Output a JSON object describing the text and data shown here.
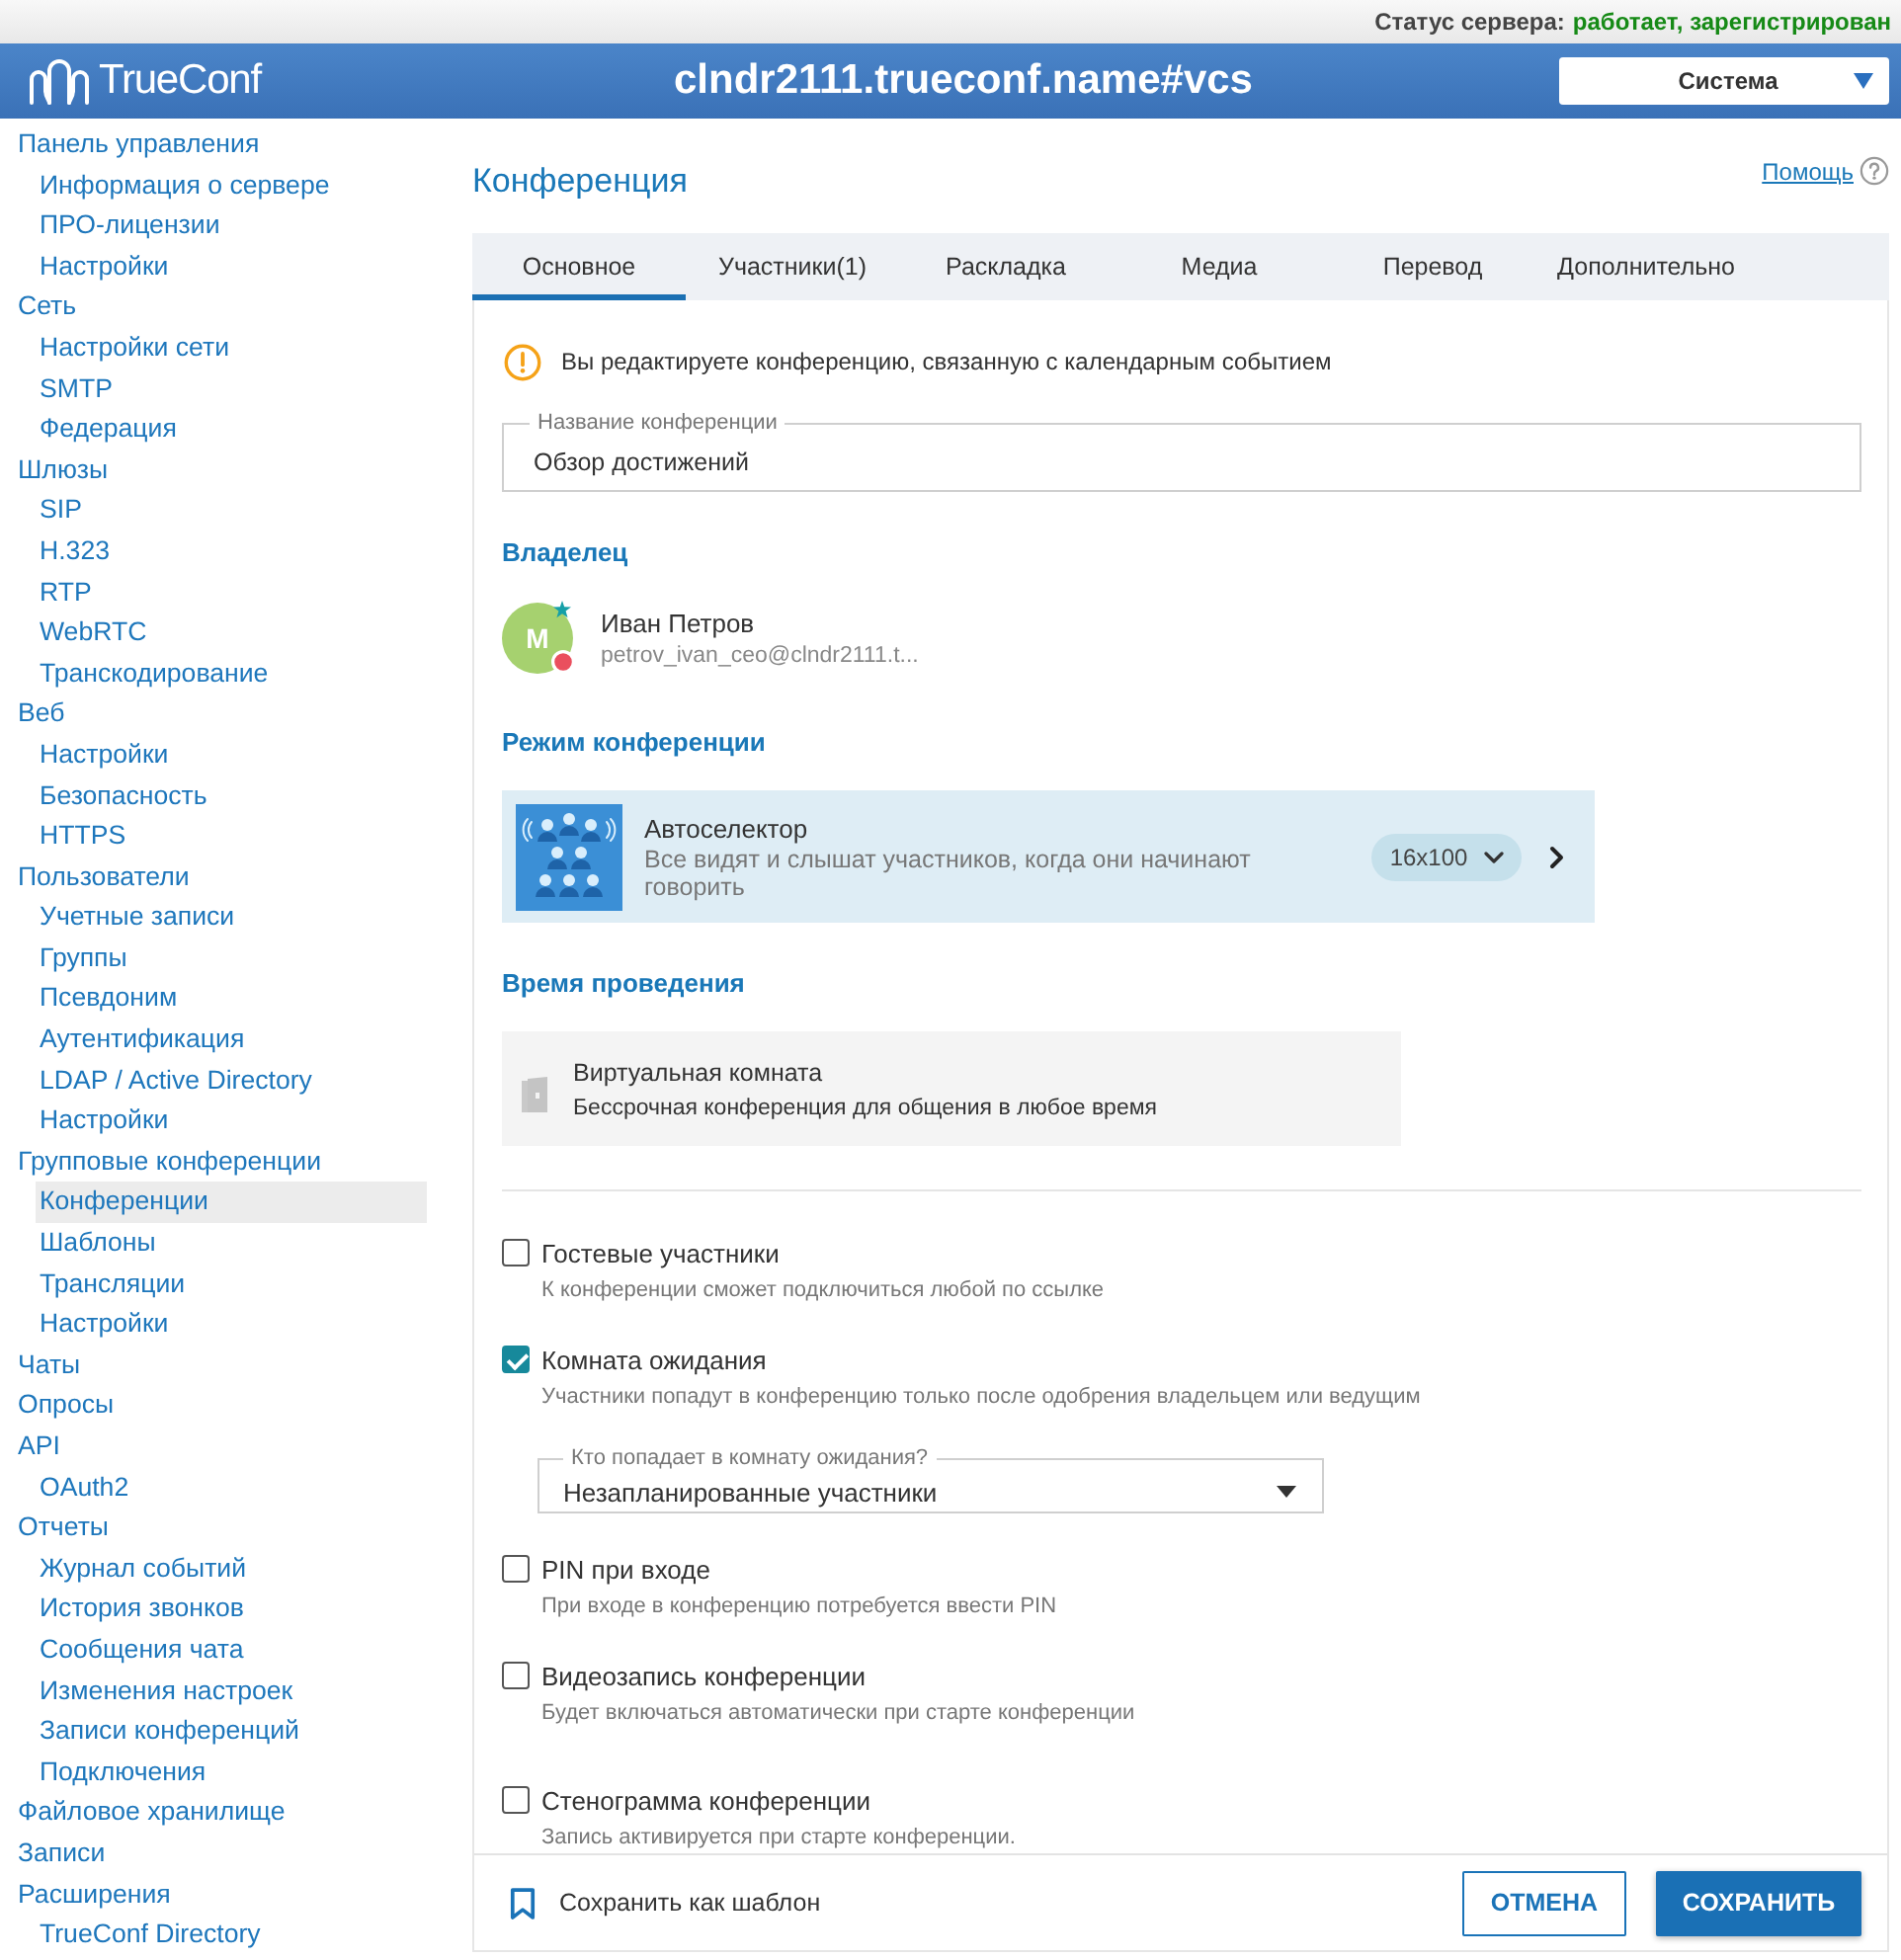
{
  "status_bar": {
    "label": "Статус сервера:",
    "value": "работает, зарегистрирован"
  },
  "header": {
    "logo": "TrueConf",
    "title": "clndr2111.trueconf.name#vcs",
    "selector": {
      "value": "Система"
    }
  },
  "sidebar": {
    "items": [
      {
        "label": "Панель управления",
        "selected": false,
        "children": [
          {
            "label": "Информация о сервере",
            "selected": false
          },
          {
            "label": "ПРО-лицензии",
            "selected": false
          },
          {
            "label": "Настройки",
            "selected": false
          }
        ]
      },
      {
        "label": "Сеть",
        "selected": false,
        "children": [
          {
            "label": "Настройки сети",
            "selected": false
          },
          {
            "label": "SMTP",
            "selected": false
          },
          {
            "label": "Федерация",
            "selected": false
          }
        ]
      },
      {
        "label": "Шлюзы",
        "selected": false,
        "children": [
          {
            "label": "SIP",
            "selected": false
          },
          {
            "label": "H.323",
            "selected": false
          },
          {
            "label": "RTP",
            "selected": false
          },
          {
            "label": "WebRTC",
            "selected": false
          },
          {
            "label": "Транскодирование",
            "selected": false
          }
        ]
      },
      {
        "label": "Веб",
        "selected": false,
        "children": [
          {
            "label": "Настройки",
            "selected": false
          },
          {
            "label": "Безопасность",
            "selected": false
          },
          {
            "label": "HTTPS",
            "selected": false
          }
        ]
      },
      {
        "label": "Пользователи",
        "selected": false,
        "children": [
          {
            "label": "Учетные записи",
            "selected": false
          },
          {
            "label": "Группы",
            "selected": false
          },
          {
            "label": "Псевдоним",
            "selected": false
          },
          {
            "label": "Аутентификация",
            "selected": false
          },
          {
            "label": "LDAP / Active Directory",
            "selected": false
          },
          {
            "label": "Настройки",
            "selected": false
          }
        ]
      },
      {
        "label": "Групповые конференции",
        "selected": false,
        "children": [
          {
            "label": "Конференции",
            "selected": true
          },
          {
            "label": "Шаблоны",
            "selected": false
          },
          {
            "label": "Трансляции",
            "selected": false
          },
          {
            "label": "Настройки",
            "selected": false
          }
        ]
      },
      {
        "label": "Чаты",
        "selected": false
      },
      {
        "label": "Опросы",
        "selected": false
      },
      {
        "label": "API",
        "selected": false,
        "children": [
          {
            "label": "OAuth2",
            "selected": false
          }
        ]
      },
      {
        "label": "Отчеты",
        "selected": false,
        "children": [
          {
            "label": "Журнал событий",
            "selected": false
          },
          {
            "label": "История звонков",
            "selected": false
          },
          {
            "label": "Сообщения чата",
            "selected": false
          },
          {
            "label": "Изменения настроек",
            "selected": false
          },
          {
            "label": "Записи конференций",
            "selected": false
          },
          {
            "label": "Подключения",
            "selected": false
          }
        ]
      },
      {
        "label": "Файловое хранилище",
        "selected": false
      },
      {
        "label": "Записи",
        "selected": false
      },
      {
        "label": "Расширения",
        "selected": false,
        "children": [
          {
            "label": "TrueConf Directory",
            "selected": false
          }
        ]
      }
    ]
  },
  "page": {
    "title": "Конференция",
    "help_link": "Помощь"
  },
  "tabs": [
    {
      "label": "Основное",
      "selected": true
    },
    {
      "label": "Участники(1)",
      "selected": false
    },
    {
      "label": "Раскладка",
      "selected": false
    },
    {
      "label": "Медиа",
      "selected": false
    },
    {
      "label": "Перевод",
      "selected": false
    },
    {
      "label": "Дополнительно",
      "selected": false
    }
  ],
  "notice": "Вы редактируете конференцию, связанную с календарным событием",
  "name_field": {
    "label": "Название конференции",
    "value": "Обзор достижений"
  },
  "owner": {
    "heading": "Владелец",
    "avatar_letter": "М",
    "name": "Иван Петров",
    "email": "petrov_ivan_ceo@clndr2111.t..."
  },
  "mode": {
    "heading": "Режим конференции",
    "title": "Автоселектор",
    "description": "Все видят и слышат участников, когда они начинают говорить",
    "layout": {
      "value": "16x100"
    }
  },
  "schedule": {
    "heading": "Время проведения",
    "title": "Виртуальная комната",
    "description": "Бессрочная конференция для общения в любое время"
  },
  "options": [
    {
      "label": "Гостевые участники",
      "description": "К конференции сможет подключиться любой по ссылке",
      "checked": false
    },
    {
      "label": "Комната ожидания",
      "description": "Участники попадут в конференцию только после одобрения владельцем или ведущим",
      "checked": true,
      "select": {
        "label": "Кто попадает в комнату ожидания?",
        "value": "Незапланированные участники"
      }
    },
    {
      "label": "PIN при входе",
      "description": "При входе в конференцию потребуется ввести PIN",
      "checked": false
    },
    {
      "label": "Видеозапись конференции",
      "description": "Будет включаться автоматически при старте конференции",
      "checked": false
    },
    {
      "label": "Стенограмма конференции",
      "description": "Запись активируется при старте конференции.",
      "checked": false
    }
  ],
  "footer": {
    "template_link": "Сохранить как шаблон",
    "buttons": [
      {
        "label": "ОТМЕНА",
        "kind": "secondary"
      },
      {
        "label": "СОХРАНИТЬ",
        "kind": "primary"
      }
    ]
  }
}
